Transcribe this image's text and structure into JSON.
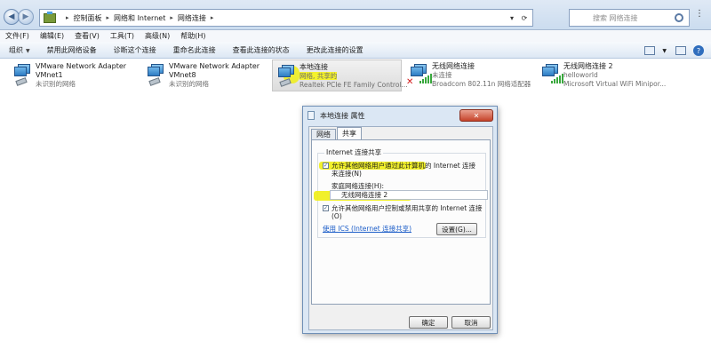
{
  "address": {
    "breadcrumb": [
      "控制面板",
      "网络和 Internet",
      "网络连接"
    ],
    "search_placeholder": "搜索 网络连接"
  },
  "menu": [
    "文件(F)",
    "编辑(E)",
    "查看(V)",
    "工具(T)",
    "高级(N)",
    "帮助(H)"
  ],
  "toolbar": [
    "组织",
    "禁用此网络设备",
    "诊断这个连接",
    "重命名此连接",
    "查看此连接的状态",
    "更改此连接的设置"
  ],
  "adapters": [
    {
      "name": "VMware Network Adapter",
      "name2": "VMnet1",
      "status": "未识别的网络"
    },
    {
      "name": "VMware Network Adapter",
      "name2": "VMnet8",
      "status": "未识别的网络"
    },
    {
      "name": "本地连接",
      "status": "网络, 共享的",
      "device": "Realtek PCIe FE Family Control..."
    },
    {
      "name": "无线网络连接",
      "status": "未连接",
      "device": "Broadcom 802.11n 网络适配器"
    },
    {
      "name": "无线网络连接 2",
      "status": "helloworld",
      "device": "Microsoft Virtual WiFi Minipor..."
    }
  ],
  "dialog": {
    "title": "本地连接 属性",
    "tabs": [
      "网络",
      "共享"
    ],
    "group_title": "Internet 连接共享",
    "opt1_line1": "允许其他网络用户通过此计算机的 Internet 连接",
    "opt1_line2": "来连接(N)",
    "home_label": "家庭网络连接(H):",
    "home_value": "无线网络连接 2",
    "opt2_line1": "允许其他网络用户控制或禁用共享的 Internet 连接",
    "opt2_line2": "(O)",
    "link": "使用 ICS (Internet 连接共享)",
    "settings_button": "设置(G)...",
    "ok_button": "确定",
    "cancel_button": "取消"
  }
}
